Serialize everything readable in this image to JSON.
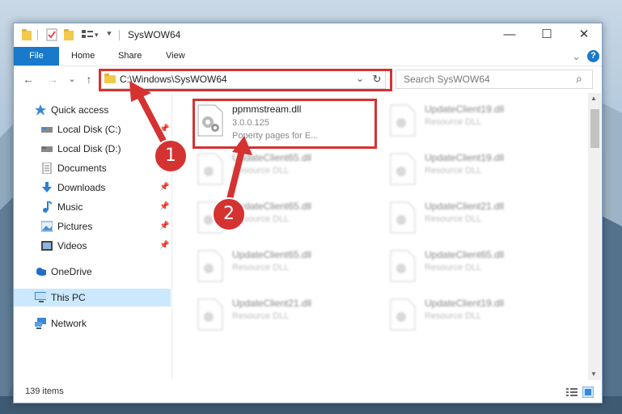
{
  "window": {
    "title": "SysWOW64",
    "minimize_glyph": "—",
    "maximize_glyph": "☐",
    "close_glyph": "✕"
  },
  "ribbon": {
    "file": "File",
    "home": "Home",
    "share": "Share",
    "view": "View",
    "help_glyph": "?",
    "expand_glyph": "⌄"
  },
  "navigation": {
    "back_glyph": "←",
    "forward_glyph": "→",
    "recent_glyph": "⌄",
    "up_glyph": "↑",
    "address": "C:\\Windows\\SysWOW64",
    "address_dropdown_glyph": "⌄",
    "refresh_glyph": "↻",
    "search_placeholder": "Search SysWOW64",
    "search_glyph": "⌕"
  },
  "sidebar": {
    "items": [
      {
        "label": "Quick access",
        "icon": "star-icon",
        "pinned": false
      },
      {
        "label": "Local Disk (C:)",
        "icon": "drive-icon",
        "pinned": true
      },
      {
        "label": "Local Disk (D:)",
        "icon": "drive-icon",
        "pinned": false
      },
      {
        "label": "Documents",
        "icon": "documents-icon",
        "pinned": true
      },
      {
        "label": "Downloads",
        "icon": "download-icon",
        "pinned": true
      },
      {
        "label": "Music",
        "icon": "music-icon",
        "pinned": true
      },
      {
        "label": "Pictures",
        "icon": "pictures-icon",
        "pinned": true
      },
      {
        "label": "Videos",
        "icon": "videos-icon",
        "pinned": true
      },
      {
        "label": "OneDrive",
        "icon": "cloud-icon",
        "pinned": false
      },
      {
        "label": "This PC",
        "icon": "computer-icon",
        "pinned": false,
        "selected": true
      },
      {
        "label": "Network",
        "icon": "network-icon",
        "pinned": false
      }
    ]
  },
  "files": {
    "highlighted": {
      "name": "ppmmstream.dll",
      "version": "3.0.0.125",
      "description": "Poperty pages for E..."
    },
    "left_column": [
      {
        "name": "UpdateClient65.dll",
        "description": "Resource DLL"
      },
      {
        "name": "UpdateClient65.dll",
        "description": "Resource DLL"
      },
      {
        "name": "UpdateClient65.dll",
        "description": "Resource DLL"
      },
      {
        "name": "UpdateClient21.dll",
        "description": "Resource DLL"
      }
    ],
    "right_column": [
      {
        "name": "UpdateClient19.dll",
        "description": "Resource DLL"
      },
      {
        "name": "UpdateClient19.dll",
        "description": "Resource DLL"
      },
      {
        "name": "UpdateClient21.dll",
        "description": "Resource DLL"
      },
      {
        "name": "UpdateClient65.dll",
        "description": "Resource DLL"
      },
      {
        "name": "UpdateClient19.dll",
        "description": "Resource DLL"
      }
    ]
  },
  "status": {
    "item_count": "139 items"
  },
  "annotations": {
    "step1": "1",
    "step2": "2",
    "color": "#d53232"
  },
  "colors": {
    "accent": "#1979ca",
    "selection": "#cce8ff"
  }
}
